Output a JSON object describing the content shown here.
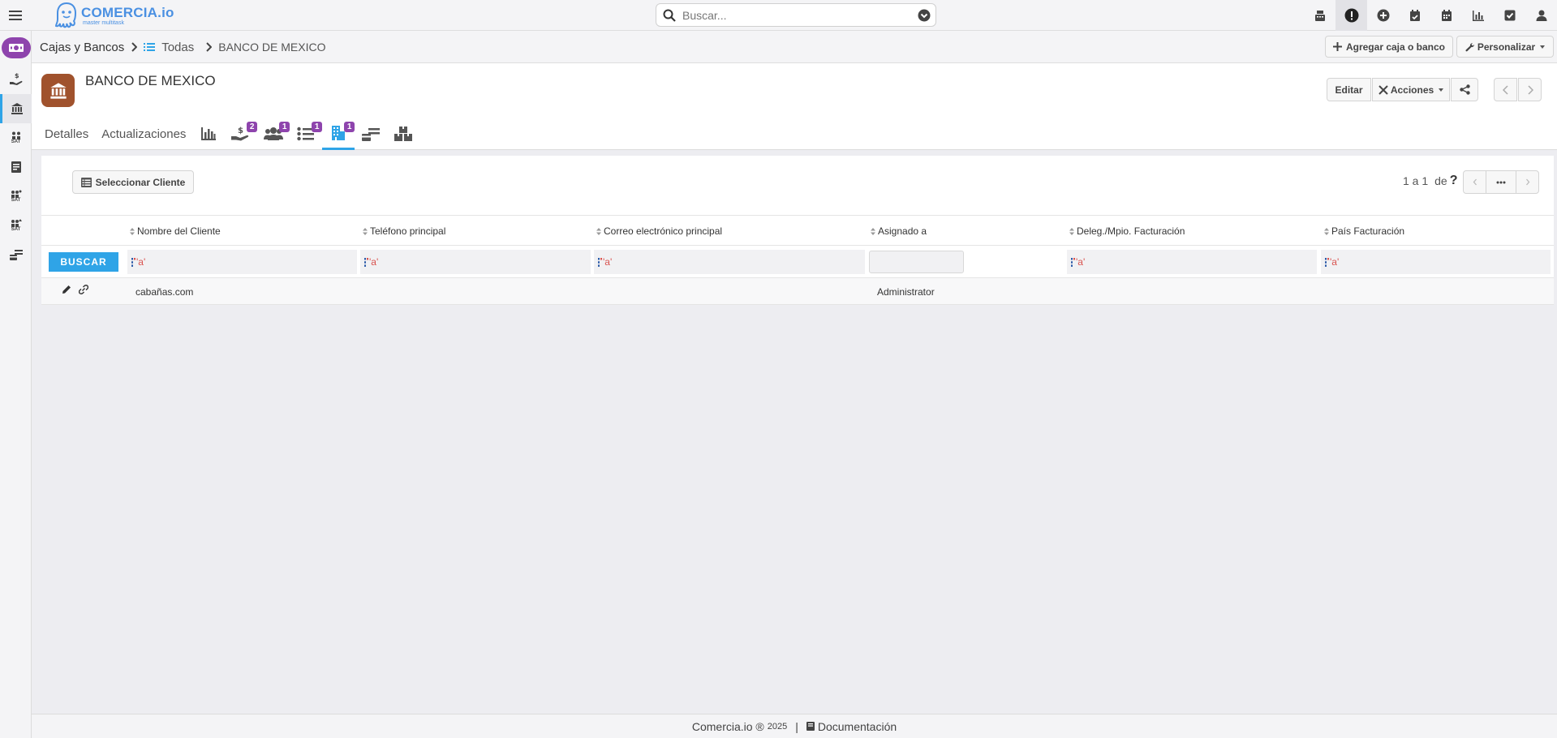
{
  "app": {
    "logo_name": "COMERCIA.io",
    "logo_tagline": "master multitask"
  },
  "search": {
    "placeholder": "Buscar..."
  },
  "top_icons": [
    "pos-register-icon",
    "alert-icon",
    "plus-circle-icon",
    "calendar-check-icon",
    "calendar-icon",
    "bar-chart-icon",
    "checkbox-icon",
    "user-icon"
  ],
  "sidebar": {
    "items": [
      {
        "name": "cajas-bancos-icon"
      },
      {
        "name": "hand-money-icon"
      },
      {
        "name": "bank-icon"
      },
      {
        "name": "sat-icon",
        "label": "SAT"
      },
      {
        "name": "document-icon"
      },
      {
        "name": "sat-pay-icon",
        "label": "SAT"
      },
      {
        "name": "sat-up-icon",
        "label": "SAT"
      },
      {
        "name": "card-list-icon"
      }
    ]
  },
  "breadcrumb": {
    "module": "Cajas y Bancos",
    "list": "Todas",
    "current": "BANCO DE MEXICO"
  },
  "toolbar": {
    "add_label": "Agregar caja o banco",
    "customize_label": "Personalizar"
  },
  "record": {
    "title": "BANCO DE MEXICO",
    "edit_label": "Editar",
    "actions_label": "Acciones"
  },
  "tabs": {
    "details": "Detalles",
    "updates": "Actualizaciones",
    "badges": {
      "payments": "2",
      "contacts": "1",
      "tasks": "1",
      "clients": "1"
    }
  },
  "subpanel": {
    "select_label": "Seleccionar Cliente",
    "pager": {
      "range": "1 a 1",
      "of": "de",
      "total": "?"
    }
  },
  "table": {
    "columns": [
      "Nombre del Cliente",
      "Teléfono principal",
      "Correo electrónico principal",
      "Asignado a",
      "Deleg./Mpio. Facturación",
      "País Facturación"
    ],
    "search_label": "BUSCAR",
    "filter_operator": "'a'",
    "rows": [
      {
        "cells": [
          "cabañas.com",
          "",
          "",
          "Administrator",
          "",
          ""
        ]
      }
    ]
  },
  "footer": {
    "brand": "Comercia.io ®",
    "year": "2025",
    "separator": "|",
    "docs_label": "Documentación"
  },
  "colors": {
    "accent": "#2fa4e7",
    "badge": "#8e44ad",
    "record_icon": "#a0522d",
    "logo": "#4a90e2"
  }
}
